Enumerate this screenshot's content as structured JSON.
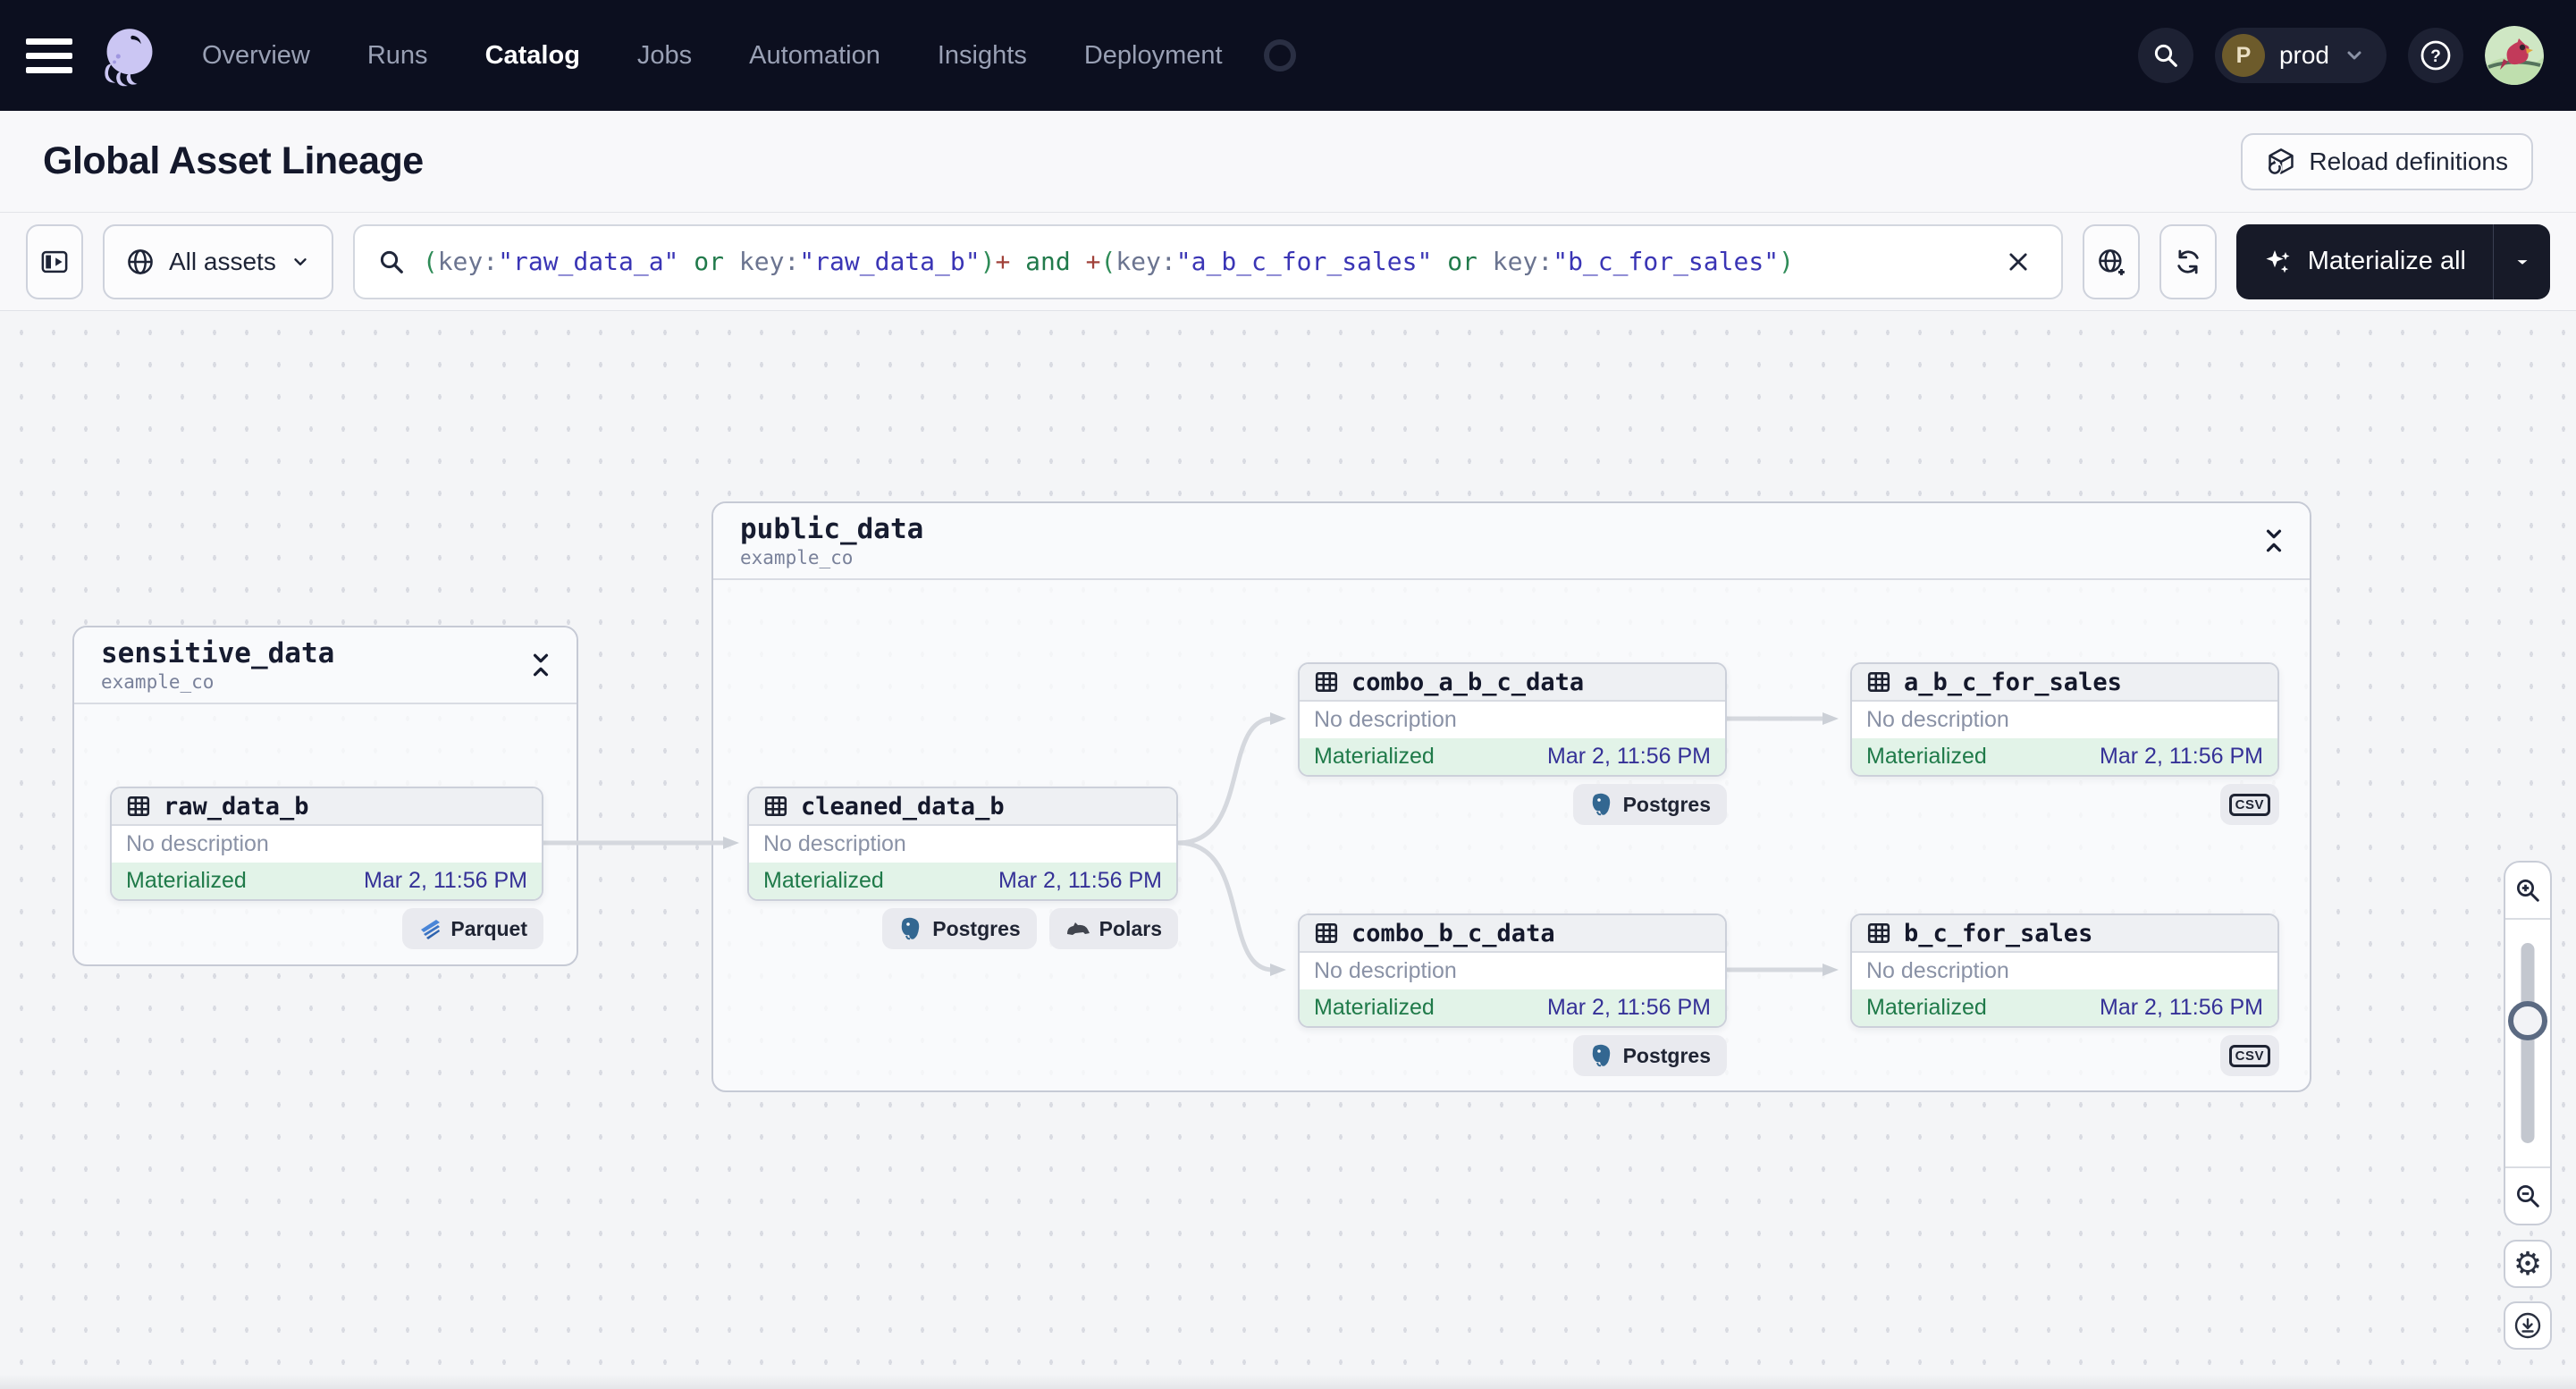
{
  "topnav": {
    "items": [
      {
        "label": "Overview",
        "active": false
      },
      {
        "label": "Runs",
        "active": false
      },
      {
        "label": "Catalog",
        "active": true
      },
      {
        "label": "Jobs",
        "active": false
      },
      {
        "label": "Automation",
        "active": false
      },
      {
        "label": "Insights",
        "active": false
      },
      {
        "label": "Deployment",
        "active": false
      }
    ],
    "env": {
      "initial": "P",
      "name": "prod"
    },
    "help_glyph": "?"
  },
  "header": {
    "title": "Global Asset Lineage",
    "reload_button": "Reload definitions"
  },
  "toolbar": {
    "filter_button": "All assets",
    "materialize_button": "Materialize all",
    "query_tokens": [
      {
        "text": "("
      },
      {
        "text": "key:"
      },
      {
        "text": "\"raw_data_a\""
      },
      {
        "text": " or "
      },
      {
        "text": "key:"
      },
      {
        "text": "\"raw_data_b\""
      },
      {
        "text": ")"
      },
      {
        "text": "+"
      },
      {
        "text": " and "
      },
      {
        "text": "+"
      },
      {
        "text": "("
      },
      {
        "text": "key:"
      },
      {
        "text": "\"a_b_c_for_sales\""
      },
      {
        "text": " or "
      },
      {
        "text": "key:"
      },
      {
        "text": "\"b_c_for_sales\""
      },
      {
        "text": ")"
      }
    ]
  },
  "graph": {
    "groups": [
      {
        "name": "sensitive_data",
        "location": "example_co"
      },
      {
        "name": "public_data",
        "location": "example_co"
      }
    ],
    "nodes": [
      {
        "title": "raw_data_b",
        "description": "No description",
        "status": "Materialized",
        "timestamp": "Mar 2, 11:56 PM",
        "badges": [
          "Parquet"
        ]
      },
      {
        "title": "cleaned_data_b",
        "description": "No description",
        "status": "Materialized",
        "timestamp": "Mar 2, 11:56 PM",
        "badges": [
          "Postgres",
          "Polars"
        ]
      },
      {
        "title": "combo_a_b_c_data",
        "description": "No description",
        "status": "Materialized",
        "timestamp": "Mar 2, 11:56 PM",
        "badges": [
          "Postgres"
        ]
      },
      {
        "title": "a_b_c_for_sales",
        "description": "No description",
        "status": "Materialized",
        "timestamp": "Mar 2, 11:56 PM",
        "badges": [
          "CSV"
        ]
      },
      {
        "title": "combo_b_c_data",
        "description": "No description",
        "status": "Materialized",
        "timestamp": "Mar 2, 11:56 PM",
        "badges": [
          "Postgres"
        ]
      },
      {
        "title": "b_c_for_sales",
        "description": "No description",
        "status": "Materialized",
        "timestamp": "Mar 2, 11:56 PM",
        "badges": [
          "CSV"
        ]
      }
    ]
  },
  "controls": {
    "gear_glyph": "⚙"
  },
  "colors": {
    "nav_bg": "#0c0f1f",
    "materialized_bg": "#e2f3e8",
    "materialized_text": "#1f7a49",
    "timestamp_text": "#353197",
    "edge": "#d5d8de",
    "accent_dark_button": "#171a28"
  }
}
